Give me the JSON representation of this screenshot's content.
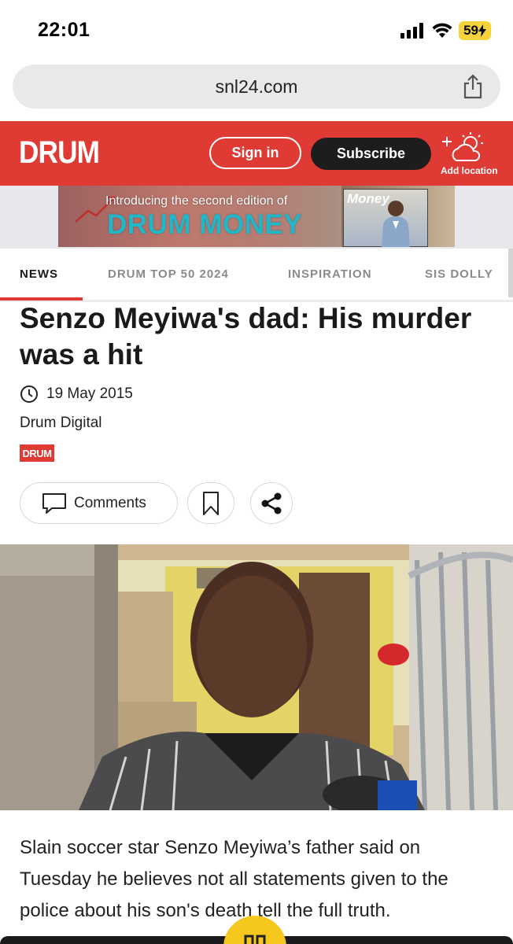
{
  "status_bar": {
    "time": "22:01",
    "battery": "59"
  },
  "browser": {
    "url": "snl24.com",
    "share_icon": "share-icon"
  },
  "header": {
    "logo": "DRUM",
    "sign_in": "Sign in",
    "subscribe": "Subscribe",
    "weather_icon": "partly-sunny-icon",
    "add_location": "Add location",
    "brand_color": "#e03a35"
  },
  "banner": {
    "intro": "Introducing the second edition of",
    "title": "DRUM MONEY",
    "magazine_title": "Money"
  },
  "nav": {
    "tabs": [
      {
        "label": "NEWS",
        "active": true
      },
      {
        "label": "DRUM TOP 50 2024",
        "active": false
      },
      {
        "label": "INSPIRATION",
        "active": false
      },
      {
        "label": "SIS DOLLY",
        "active": false
      }
    ]
  },
  "article": {
    "headline": "Senzo Meyiwa's dad: His murder was a hit",
    "date": "19 May 2015",
    "author": "Drum Digital",
    "badge": "DRUM",
    "comments_label": "Comments",
    "body": "Slain soccer star Senzo Meyiwa’s father said on Tuesday he believes not all statements given to the police about his son's death tell the full truth."
  }
}
